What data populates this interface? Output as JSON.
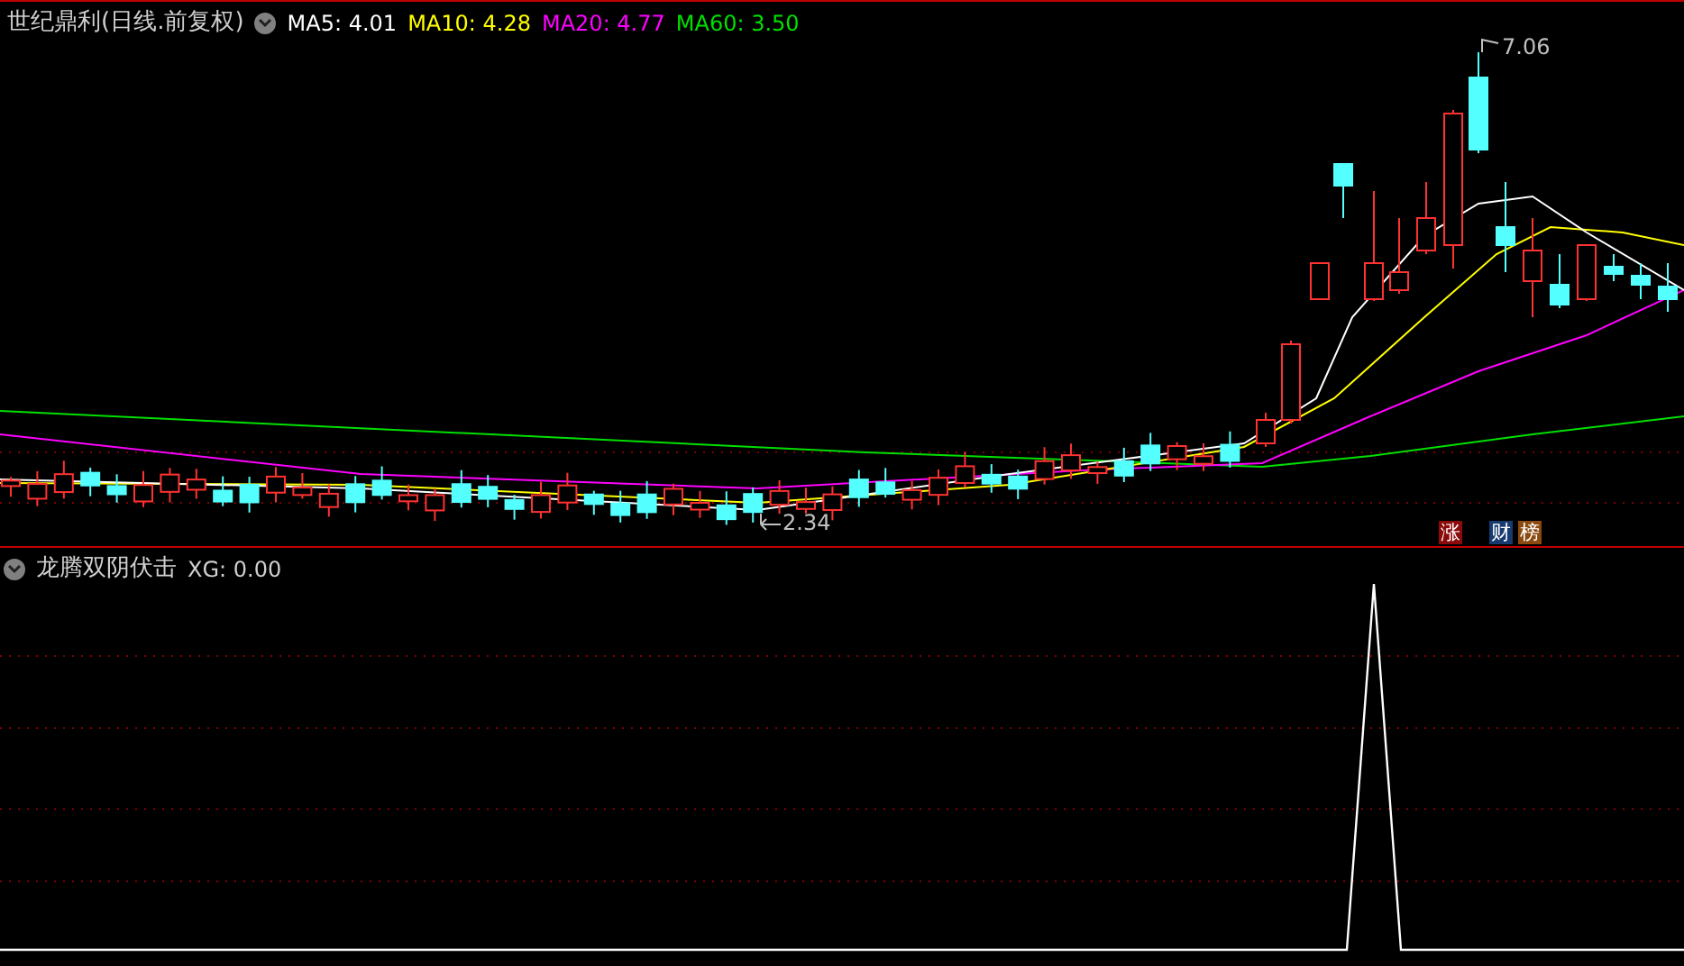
{
  "chart_header": {
    "title": "世纪鼎利(日线.前复权)",
    "ma": [
      {
        "label": "MA5: 4.01",
        "color": "#ffffff"
      },
      {
        "label": "MA10: 4.28",
        "color": "#ffff00"
      },
      {
        "label": "MA20: 4.77",
        "color": "#ff00ff"
      },
      {
        "label": "MA60: 3.50",
        "color": "#00e000"
      }
    ]
  },
  "price_marks": [
    {
      "kind": "high",
      "text": "7.06"
    },
    {
      "kind": "low",
      "text": "2.34"
    }
  ],
  "badges": [
    {
      "text": "涨",
      "color": "#8b0a0a"
    },
    {
      "text": "财",
      "color": "#173a70"
    },
    {
      "text": "榜",
      "color": "#8a4a10"
    }
  ],
  "indicator": {
    "name": "龙腾双阴伏击",
    "reading": "XG: 0.00"
  }
}
